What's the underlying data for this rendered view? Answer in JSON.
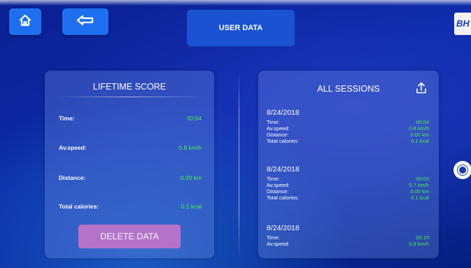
{
  "header": {
    "title": "USER DATA",
    "brand": "BH",
    "icons": {
      "home": "home-icon",
      "back": "arrow-left-icon"
    }
  },
  "lifetime": {
    "title": "LIFETIME SCORE",
    "rows": [
      {
        "label": "Time:",
        "value": "00:04"
      },
      {
        "label": "Av.speed:",
        "value": "0.8 km/h"
      },
      {
        "label": "Distance:",
        "value": "0.00 km"
      },
      {
        "label": "Total calories:",
        "value": "0.1 kcal"
      }
    ],
    "delete_label": "DELETE DATA"
  },
  "sessions": {
    "title": "ALL SESSIONS",
    "share_icon": "share-upload-icon",
    "items": [
      {
        "date": "8/24/2018",
        "rows": [
          {
            "label": "Time:",
            "value": "00:04"
          },
          {
            "label": "Av.speed:",
            "value": "0.8 km/h"
          },
          {
            "label": "Distance:",
            "value": "0.00 km"
          },
          {
            "label": "Total calories:",
            "value": "0.1 kcal"
          }
        ]
      },
      {
        "date": "8/24/2018",
        "rows": [
          {
            "label": "Time:",
            "value": "00:03"
          },
          {
            "label": "Av.speed:",
            "value": "0.7 km/h"
          },
          {
            "label": "Distance:",
            "value": "0.00 km"
          },
          {
            "label": "Total calories:",
            "value": "0.1 kcal"
          }
        ]
      },
      {
        "date": "8/24/2018",
        "rows": [
          {
            "label": "Time:",
            "value": "00:10"
          },
          {
            "label": "Av.speed:",
            "value": "0.9 km/h"
          }
        ]
      }
    ]
  },
  "colors": {
    "accent": "#1e6ff0",
    "value_green": "#49f049",
    "delete_button": "#c274c9"
  }
}
